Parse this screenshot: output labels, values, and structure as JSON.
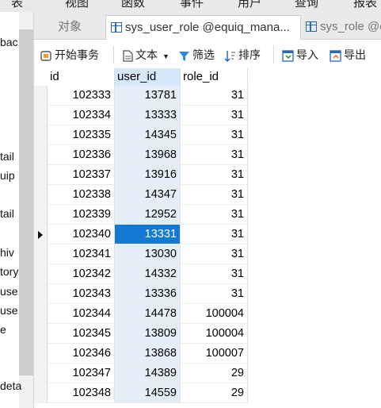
{
  "menubar": {
    "items": [
      "表",
      "视图",
      "函数",
      "事件",
      "用户",
      "查询",
      "报表"
    ]
  },
  "left_panel": {
    "fragments": [
      "bac",
      "tail",
      "uip",
      "tail",
      "hiv",
      "tory",
      "use",
      "use",
      "e",
      "deta"
    ]
  },
  "tabs": [
    {
      "label": "对象",
      "state": "inactive"
    },
    {
      "label": "sys_user_role @equiq_mana...",
      "state": "active",
      "icon": "table-icon"
    },
    {
      "label": "sys_role @e",
      "state": "inactive",
      "icon": "table-icon"
    }
  ],
  "toolbar": {
    "begin_transaction": "开始事务",
    "text": "文本",
    "filter": "筛选",
    "sort": "排序",
    "import": "导入",
    "export": "导出"
  },
  "grid": {
    "columns": [
      "id",
      "user_id",
      "role_id"
    ],
    "selected_column": "user_id",
    "current_row_index": 7,
    "rows": [
      [
        "102333",
        "13781",
        "31"
      ],
      [
        "102334",
        "13333",
        "31"
      ],
      [
        "102335",
        "14345",
        "31"
      ],
      [
        "102336",
        "13968",
        "31"
      ],
      [
        "102337",
        "13916",
        "31"
      ],
      [
        "102338",
        "14347",
        "31"
      ],
      [
        "102339",
        "12952",
        "31"
      ],
      [
        "102340",
        "13331",
        "31"
      ],
      [
        "102341",
        "13030",
        "31"
      ],
      [
        "102342",
        "14332",
        "31"
      ],
      [
        "102343",
        "13336",
        "31"
      ],
      [
        "102344",
        "14478",
        "100004"
      ],
      [
        "102345",
        "13809",
        "100004"
      ],
      [
        "102346",
        "13868",
        "100007"
      ],
      [
        "102347",
        "14389",
        "29"
      ],
      [
        "102348",
        "14559",
        "29"
      ]
    ]
  },
  "colors": {
    "selected_cell": "#1279d4",
    "selected_column_bg": "#e4eef9",
    "icon_blue": "#2a68b8"
  }
}
